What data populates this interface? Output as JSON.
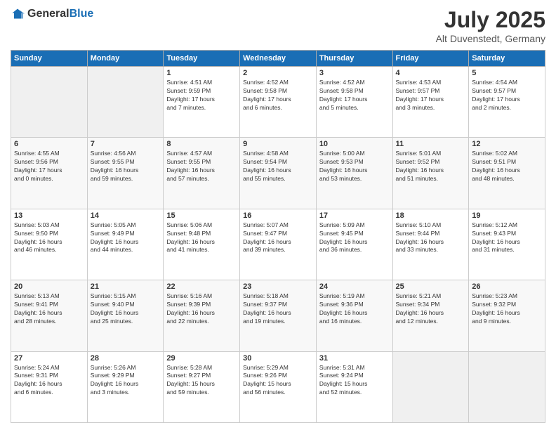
{
  "header": {
    "logo_general": "General",
    "logo_blue": "Blue",
    "month": "July 2025",
    "location": "Alt Duvenstedt, Germany"
  },
  "days_of_week": [
    "Sunday",
    "Monday",
    "Tuesday",
    "Wednesday",
    "Thursday",
    "Friday",
    "Saturday"
  ],
  "weeks": [
    [
      {
        "day": "",
        "info": ""
      },
      {
        "day": "",
        "info": ""
      },
      {
        "day": "1",
        "info": "Sunrise: 4:51 AM\nSunset: 9:59 PM\nDaylight: 17 hours\nand 7 minutes."
      },
      {
        "day": "2",
        "info": "Sunrise: 4:52 AM\nSunset: 9:58 PM\nDaylight: 17 hours\nand 6 minutes."
      },
      {
        "day": "3",
        "info": "Sunrise: 4:52 AM\nSunset: 9:58 PM\nDaylight: 17 hours\nand 5 minutes."
      },
      {
        "day": "4",
        "info": "Sunrise: 4:53 AM\nSunset: 9:57 PM\nDaylight: 17 hours\nand 3 minutes."
      },
      {
        "day": "5",
        "info": "Sunrise: 4:54 AM\nSunset: 9:57 PM\nDaylight: 17 hours\nand 2 minutes."
      }
    ],
    [
      {
        "day": "6",
        "info": "Sunrise: 4:55 AM\nSunset: 9:56 PM\nDaylight: 17 hours\nand 0 minutes."
      },
      {
        "day": "7",
        "info": "Sunrise: 4:56 AM\nSunset: 9:55 PM\nDaylight: 16 hours\nand 59 minutes."
      },
      {
        "day": "8",
        "info": "Sunrise: 4:57 AM\nSunset: 9:55 PM\nDaylight: 16 hours\nand 57 minutes."
      },
      {
        "day": "9",
        "info": "Sunrise: 4:58 AM\nSunset: 9:54 PM\nDaylight: 16 hours\nand 55 minutes."
      },
      {
        "day": "10",
        "info": "Sunrise: 5:00 AM\nSunset: 9:53 PM\nDaylight: 16 hours\nand 53 minutes."
      },
      {
        "day": "11",
        "info": "Sunrise: 5:01 AM\nSunset: 9:52 PM\nDaylight: 16 hours\nand 51 minutes."
      },
      {
        "day": "12",
        "info": "Sunrise: 5:02 AM\nSunset: 9:51 PM\nDaylight: 16 hours\nand 48 minutes."
      }
    ],
    [
      {
        "day": "13",
        "info": "Sunrise: 5:03 AM\nSunset: 9:50 PM\nDaylight: 16 hours\nand 46 minutes."
      },
      {
        "day": "14",
        "info": "Sunrise: 5:05 AM\nSunset: 9:49 PM\nDaylight: 16 hours\nand 44 minutes."
      },
      {
        "day": "15",
        "info": "Sunrise: 5:06 AM\nSunset: 9:48 PM\nDaylight: 16 hours\nand 41 minutes."
      },
      {
        "day": "16",
        "info": "Sunrise: 5:07 AM\nSunset: 9:47 PM\nDaylight: 16 hours\nand 39 minutes."
      },
      {
        "day": "17",
        "info": "Sunrise: 5:09 AM\nSunset: 9:45 PM\nDaylight: 16 hours\nand 36 minutes."
      },
      {
        "day": "18",
        "info": "Sunrise: 5:10 AM\nSunset: 9:44 PM\nDaylight: 16 hours\nand 33 minutes."
      },
      {
        "day": "19",
        "info": "Sunrise: 5:12 AM\nSunset: 9:43 PM\nDaylight: 16 hours\nand 31 minutes."
      }
    ],
    [
      {
        "day": "20",
        "info": "Sunrise: 5:13 AM\nSunset: 9:41 PM\nDaylight: 16 hours\nand 28 minutes."
      },
      {
        "day": "21",
        "info": "Sunrise: 5:15 AM\nSunset: 9:40 PM\nDaylight: 16 hours\nand 25 minutes."
      },
      {
        "day": "22",
        "info": "Sunrise: 5:16 AM\nSunset: 9:39 PM\nDaylight: 16 hours\nand 22 minutes."
      },
      {
        "day": "23",
        "info": "Sunrise: 5:18 AM\nSunset: 9:37 PM\nDaylight: 16 hours\nand 19 minutes."
      },
      {
        "day": "24",
        "info": "Sunrise: 5:19 AM\nSunset: 9:36 PM\nDaylight: 16 hours\nand 16 minutes."
      },
      {
        "day": "25",
        "info": "Sunrise: 5:21 AM\nSunset: 9:34 PM\nDaylight: 16 hours\nand 12 minutes."
      },
      {
        "day": "26",
        "info": "Sunrise: 5:23 AM\nSunset: 9:32 PM\nDaylight: 16 hours\nand 9 minutes."
      }
    ],
    [
      {
        "day": "27",
        "info": "Sunrise: 5:24 AM\nSunset: 9:31 PM\nDaylight: 16 hours\nand 6 minutes."
      },
      {
        "day": "28",
        "info": "Sunrise: 5:26 AM\nSunset: 9:29 PM\nDaylight: 16 hours\nand 3 minutes."
      },
      {
        "day": "29",
        "info": "Sunrise: 5:28 AM\nSunset: 9:27 PM\nDaylight: 15 hours\nand 59 minutes."
      },
      {
        "day": "30",
        "info": "Sunrise: 5:29 AM\nSunset: 9:26 PM\nDaylight: 15 hours\nand 56 minutes."
      },
      {
        "day": "31",
        "info": "Sunrise: 5:31 AM\nSunset: 9:24 PM\nDaylight: 15 hours\nand 52 minutes."
      },
      {
        "day": "",
        "info": ""
      },
      {
        "day": "",
        "info": ""
      }
    ]
  ]
}
